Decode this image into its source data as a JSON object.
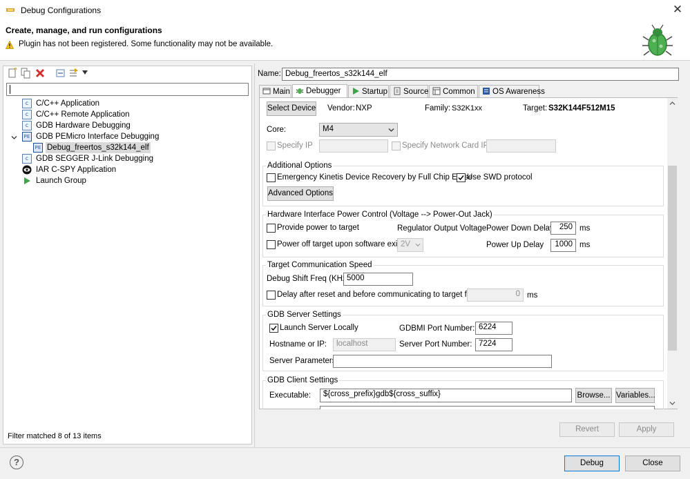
{
  "window": {
    "title": "Debug Configurations",
    "close_symbol": "✕",
    "header_title": "Create, manage, and run configurations",
    "warning_text": "Plugin has not been registered. Some functionality may not be available."
  },
  "left": {
    "filter_value": "",
    "tree": [
      {
        "label": "C/C++ Application",
        "icon": "c-icon"
      },
      {
        "label": "C/C++ Remote Application",
        "icon": "c-icon"
      },
      {
        "label": "GDB Hardware Debugging",
        "icon": "c-icon"
      },
      {
        "label": "GDB PEMicro Interface Debugging",
        "icon": "pemicro-icon"
      },
      {
        "label": "Debug_freertos_s32k144_elf",
        "icon": "pemicro-icon"
      },
      {
        "label": "GDB SEGGER J-Link Debugging",
        "icon": "c-icon"
      },
      {
        "label": "IAR C-SPY Application",
        "icon": "eye-icon"
      },
      {
        "label": "Launch Group",
        "icon": "play-icon"
      }
    ],
    "icon_text_c": "c",
    "icon_text_pe": "PE",
    "status": "Filter matched 8 of 13 items"
  },
  "right": {
    "name_label": "Name:",
    "name_value": "Debug_freertos_s32k144_elf",
    "tabs": [
      "Main",
      "Debugger",
      "Startup",
      "Source",
      "Common",
      "OS Awareness"
    ],
    "debugger": {
      "select_device": "Select Device",
      "vendor_label": "Vendor:",
      "vendor_value": "NXP",
      "family_label": "Family:",
      "family_value": "S32K1xx",
      "target_label": "Target:",
      "target_value": "S32K144F512M15",
      "core_label": "Core:",
      "core_value": "M4",
      "specify_ip": "Specify IP",
      "specify_net": "Specify Network Card IP",
      "additional_options": "Additional Options",
      "emergency_kinetis": "Emergency Kinetis Device Recovery by Full Chip Erase",
      "use_swd": "Use SWD protocol",
      "advanced_options": "Advanced Options",
      "hw_power_title": "Hardware Interface Power Control (Voltage --> Power-Out Jack)",
      "provide_power": "Provide power to target",
      "regulator_label": "Regulator Output Voltage",
      "power_down_label": "Power Down Delay",
      "power_down_value": "250",
      "ms1": "ms",
      "power_off": "Power off target upon software exit",
      "voltage_value": "2V",
      "power_up_label": "Power Up Delay",
      "power_up_value": "1000",
      "ms2": "ms",
      "comm_speed_title": "Target Communication Speed",
      "shift_freq_label": "Debug Shift Freq (KHz)",
      "shift_freq_value": "5000",
      "delay_after_reset": "Delay after reset and before communicating to target for",
      "delay_value": "0",
      "ms3": "ms",
      "gdb_server_title": "GDB Server Settings",
      "launch_server": "Launch Server Locally",
      "gdbmi_label": "GDBMI Port Number:",
      "gdbmi_value": "6224",
      "hostname_label": "Hostname or IP:",
      "hostname_value": "localhost",
      "server_port_label": "Server Port Number:",
      "server_port_value": "7224",
      "server_params_label": "Server Parameters:",
      "server_params_value": "",
      "gdb_client_title": "GDB Client Settings",
      "executable_label": "Executable:",
      "executable_value": "${cross_prefix}gdb${cross_suffix}",
      "browse": "Browse...",
      "variables": "Variables..."
    },
    "revert": "Revert",
    "apply": "Apply"
  },
  "footer": {
    "help_symbol": "?",
    "debug": "Debug",
    "close": "Close"
  },
  "colors": {
    "selection": "#d9d9d9",
    "primary_border": "#0078d7",
    "warning": "#f5c518",
    "bug_green": "#5cb85c"
  }
}
